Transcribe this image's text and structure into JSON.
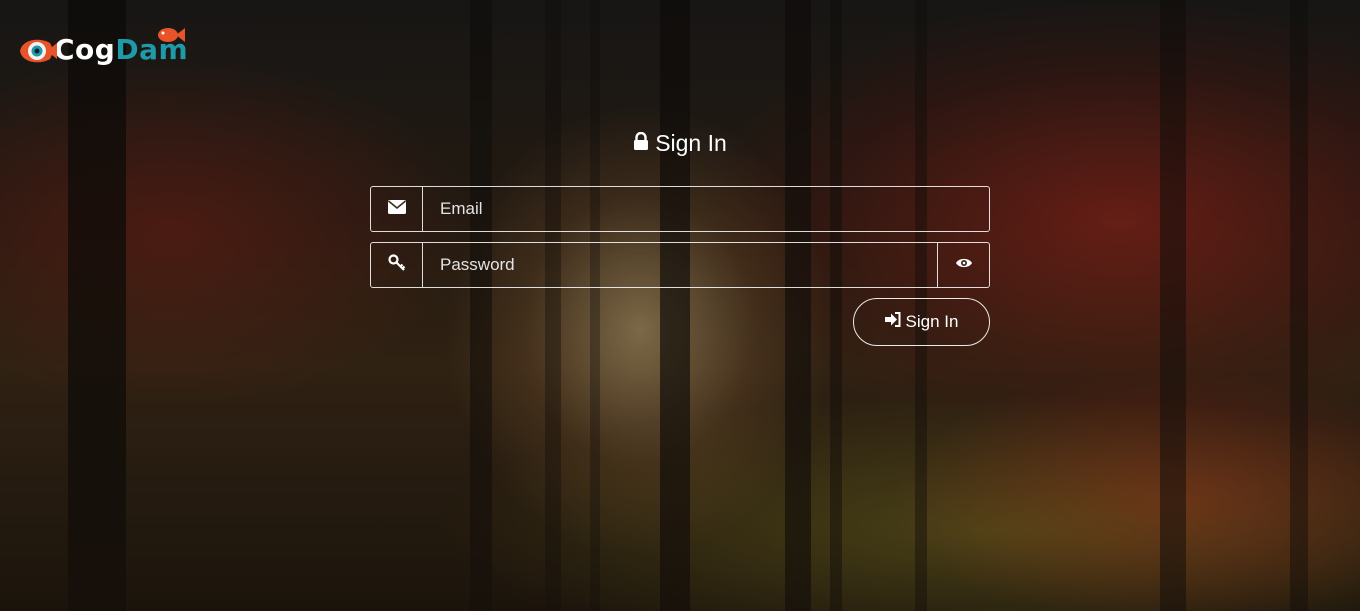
{
  "brand": {
    "part1": "Cog",
    "part2": "Dam",
    "accent": "#1f9aa8",
    "logo_color": "#e8542a"
  },
  "form": {
    "title": "Sign In",
    "email": {
      "placeholder": "Email",
      "value": "",
      "icon": "envelope-icon"
    },
    "password": {
      "placeholder": "Password",
      "value": "",
      "icon": "key-icon",
      "toggle_icon": "eye-icon"
    },
    "submit": {
      "label": "Sign In",
      "icon": "sign-in-icon"
    }
  }
}
